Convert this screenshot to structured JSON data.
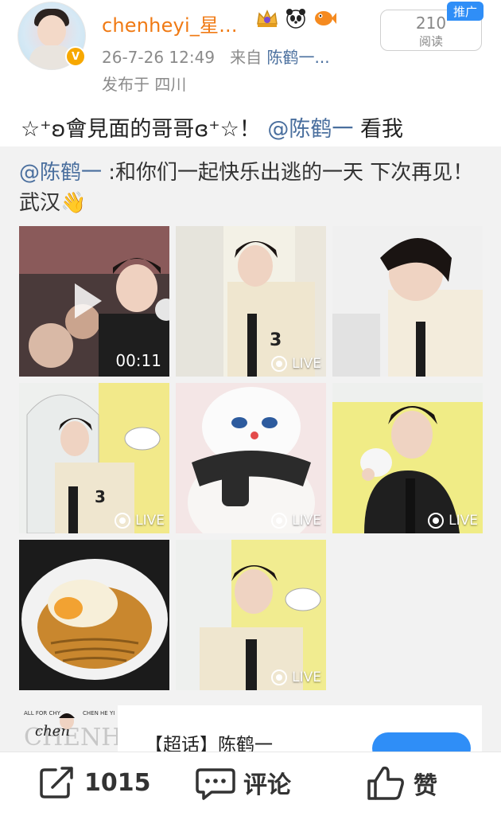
{
  "post": {
    "username": "chenheyi_星...",
    "verified_badge": "V",
    "timestamp": "26-7-26 12:49",
    "source_prefix": "来自",
    "source_name": "陈鹤一...",
    "location": "发布于 四川",
    "read_count": "210",
    "read_label": "阅读",
    "promo_tag": "推广",
    "text_pre": "☆⁺ʚ會見面的哥哥ɞ⁺☆！",
    "text_mention": "@陈鹤一",
    "text_post": " 看我"
  },
  "badges": [
    "crown-badge-icon",
    "panda-badge-icon",
    "fish-badge-icon"
  ],
  "repost": {
    "mention": "@陈鹤一",
    "text": " :和你们一起快乐出逃的一天 下次再见！武汉👋"
  },
  "media": [
    {
      "type": "video",
      "duration": "00:11"
    },
    {
      "type": "live",
      "label": "LIVE"
    },
    {
      "type": "photo"
    },
    {
      "type": "live",
      "label": "LIVE"
    },
    {
      "type": "live",
      "label": "LIVE"
    },
    {
      "type": "live",
      "label": "LIVE"
    },
    {
      "type": "photo"
    },
    {
      "type": "live",
      "label": "LIVE"
    }
  ],
  "card": {
    "title": "【超话】陈鹤一",
    "thumb_top_left": "ALL FOR CHY",
    "thumb_top_right": "CHEN HE YI",
    "thumb_big": "CHENHEYI",
    "thumb_script": "chen"
  },
  "actions": {
    "share_count": "1015",
    "comment_label": "评论",
    "like_label": "赞"
  },
  "colors": {
    "username": "#f07a14",
    "link": "#4a6f9e",
    "promo": "#2f8ef7"
  }
}
